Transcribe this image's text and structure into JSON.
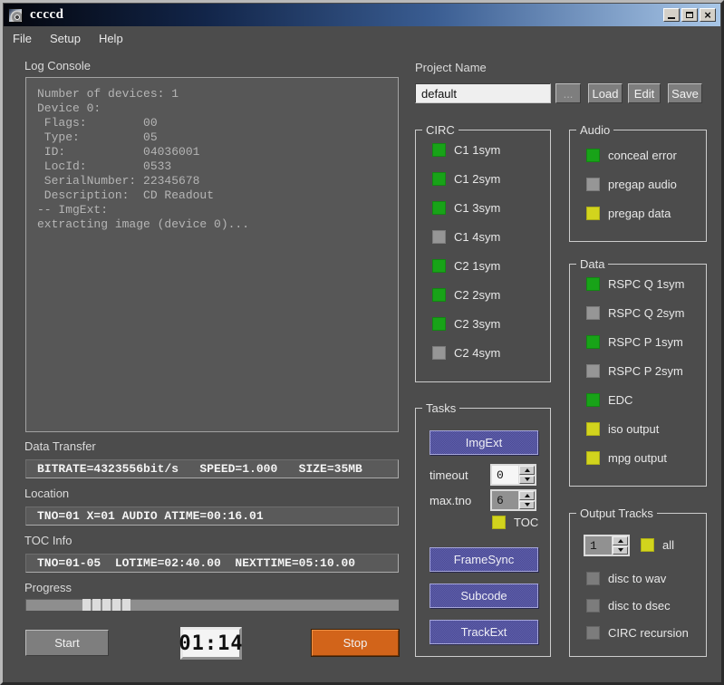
{
  "window": {
    "title": "ccccd",
    "controls": {
      "minimize": "minimize",
      "maximize": "maximize",
      "close": "close"
    }
  },
  "menu": {
    "file": "File",
    "setup": "Setup",
    "help": "Help"
  },
  "log_console": {
    "label": "Log Console",
    "text": "Number of devices: 1\nDevice 0:\n Flags:        00\n Type:         05\n ID:           04036001\n LocId:        0533\n SerialNumber: 22345678\n Description:  CD Readout\n-- ImgExt:\nextracting image (device 0)..."
  },
  "project": {
    "label": "Project Name",
    "value": "default",
    "browse_label": "...",
    "load_label": "Load",
    "edit_label": "Edit",
    "save_label": "Save"
  },
  "groups": {
    "circ": {
      "title": "CIRC",
      "items": [
        {
          "label": "C1 1sym",
          "state": "green"
        },
        {
          "label": "C1 2sym",
          "state": "green"
        },
        {
          "label": "C1 3sym",
          "state": "green"
        },
        {
          "label": "C1 4sym",
          "state": "gray"
        },
        {
          "label": "C2 1sym",
          "state": "green"
        },
        {
          "label": "C2 2sym",
          "state": "green"
        },
        {
          "label": "C2 3sym",
          "state": "green"
        },
        {
          "label": "C2 4sym",
          "state": "gray"
        }
      ]
    },
    "audio": {
      "title": "Audio",
      "items": [
        {
          "label": "conceal error",
          "state": "green"
        },
        {
          "label": "pregap audio",
          "state": "gray"
        },
        {
          "label": "pregap data",
          "state": "yellow"
        }
      ]
    },
    "data": {
      "title": "Data",
      "items": [
        {
          "label": "RSPC Q 1sym",
          "state": "green"
        },
        {
          "label": "RSPC Q 2sym",
          "state": "gray"
        },
        {
          "label": "RSPC P 1sym",
          "state": "green"
        },
        {
          "label": "RSPC P 2sym",
          "state": "gray"
        },
        {
          "label": "EDC",
          "state": "green"
        },
        {
          "label": "iso output",
          "state": "yellow"
        },
        {
          "label": "mpg output",
          "state": "yellow"
        }
      ]
    },
    "tasks": {
      "title": "Tasks",
      "imgext_label": "ImgExt",
      "framesync_label": "FrameSync",
      "subcode_label": "Subcode",
      "trackext_label": "TrackExt",
      "timeout": {
        "label": "timeout",
        "value": "0"
      },
      "max_tno": {
        "label": "max.tno",
        "value": "6"
      },
      "toc": {
        "label": "TOC",
        "state": "yellow"
      }
    },
    "output_tracks": {
      "title": "Output Tracks",
      "track_value": "1",
      "all": {
        "label": "all",
        "state": "yellow"
      },
      "items": [
        {
          "label": "disc to wav",
          "state": "dimgray"
        },
        {
          "label": "disc to dsec",
          "state": "dimgray"
        },
        {
          "label": "CIRC recursion",
          "state": "dimgray"
        }
      ]
    }
  },
  "status": {
    "data_transfer": {
      "label": "Data Transfer",
      "value": "BITRATE=4323556bit/s   SPEED=1.000   SIZE=35MB"
    },
    "location": {
      "label": "Location",
      "value": "TNO=01 X=01 AUDIO ATIME=00:16.01"
    },
    "toc_info": {
      "label": "TOC Info",
      "value": "TNO=01-05  LOTIME=02:40.00  NEXTTIME=05:10.00"
    }
  },
  "progress": {
    "label": "Progress",
    "segments": 5
  },
  "controls": {
    "start_label": "Start",
    "stop_label": "Stop",
    "lcd_value": "01:14"
  },
  "colors": {
    "enabled_green": "#18a318",
    "selected_yellow": "#d2d41d",
    "disabled_gray": "#969696",
    "stop_orange": "#d2641a",
    "task_button_purple": "#5555a0"
  }
}
